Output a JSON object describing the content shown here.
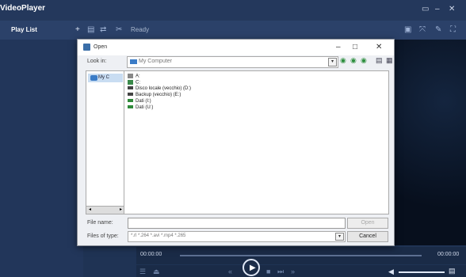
{
  "app": {
    "title": "VideoPlayer",
    "playlist_label": "Play List",
    "status": "Ready",
    "window_controls": [
      "▭",
      "–",
      "✕"
    ],
    "toolbar_icons": [
      "+",
      "▤",
      "⇄",
      "✂"
    ],
    "right_icons": [
      "▣",
      "⤧",
      "✎",
      "⛶"
    ]
  },
  "dialog": {
    "title": "Open",
    "controls": [
      "–",
      "□",
      "✕"
    ],
    "look_in_label": "Look in:",
    "look_in_value": "My Computer",
    "nav_icons": [
      "◉",
      "◉",
      "◉"
    ],
    "view_icons": [
      "▤",
      "▦"
    ],
    "places": [
      {
        "label": "My C"
      }
    ],
    "files": [
      {
        "label": "A:"
      },
      {
        "label": "C:"
      },
      {
        "label": "Disco locale (vecchio) (D:)"
      },
      {
        "label": "Backup (vecchio) (E:)"
      },
      {
        "label": "Dati (I:)"
      },
      {
        "label": "Dati (U:)"
      }
    ],
    "file_name_label": "File name:",
    "file_name_value": "",
    "open_button": "Open",
    "file_type_label": "Files of type:",
    "file_type_value": "*.rl *.264 *.avi *.mp4 *.265",
    "cancel_button": "Cancel"
  },
  "playback": {
    "elapsed": "00:00:00",
    "total": "00:00:00",
    "progress": 0
  },
  "colors": {
    "titlebar": "#24385c",
    "dialog_bg": "#eef0f4",
    "selection": "#c9ddf2"
  }
}
